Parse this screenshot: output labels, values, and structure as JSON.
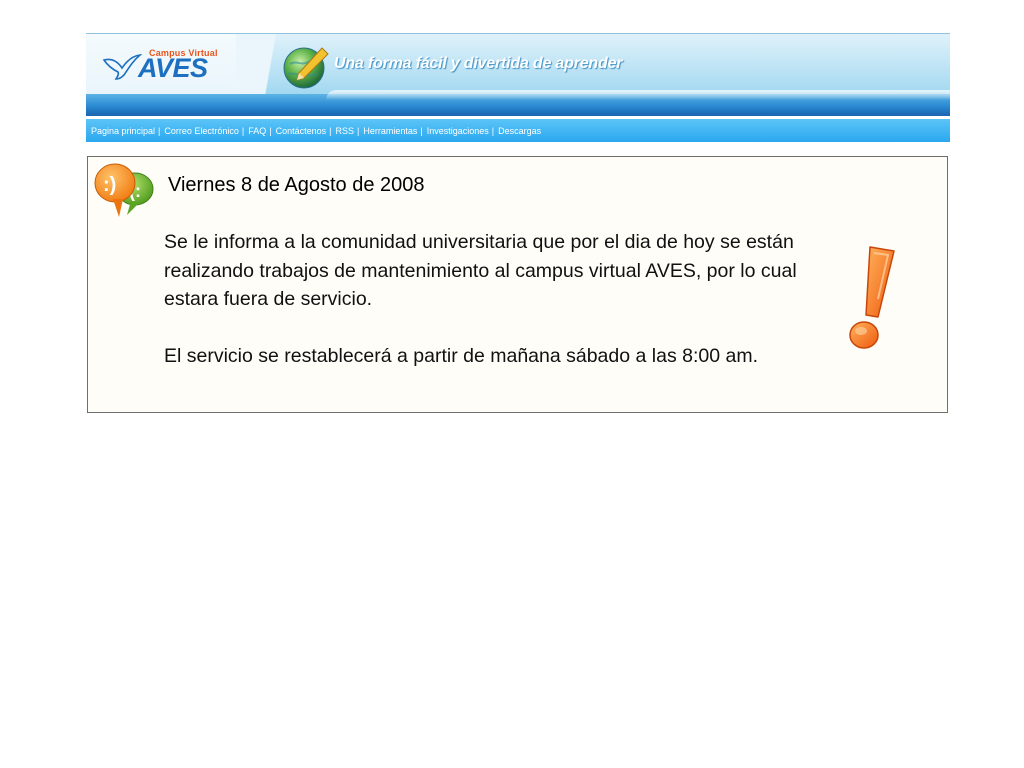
{
  "header": {
    "logo_small": "Campus Virtual",
    "logo_big": "AVES",
    "slogan": "Una forma fácil y divertida de aprender"
  },
  "nav": {
    "items": [
      "Pagina principal",
      "Correo Electrónico",
      "FAQ",
      "Contáctenos",
      "RSS",
      "Herramientas",
      "Investigaciones",
      "Descargas"
    ],
    "separator": "|"
  },
  "notice": {
    "date": "Viernes 8 de Agosto de 2008",
    "paragraph1": "Se le informa a la comunidad universitaria que por el dia de hoy se están realizando trabajos de mantenimiento al campus virtual AVES, por lo cual estara fuera de servicio.",
    "paragraph2": "El servicio se restablecerá a partir de mañana sábado a las 8:00 am.",
    "icons": [
      "chat-bubbles-icon",
      "exclamation-icon"
    ]
  },
  "colors": {
    "logo_orange": "#e8541c",
    "logo_blue": "#1d6fc0",
    "nav_blue": "#2aa8ef",
    "notice_border": "#6e6e6e"
  }
}
